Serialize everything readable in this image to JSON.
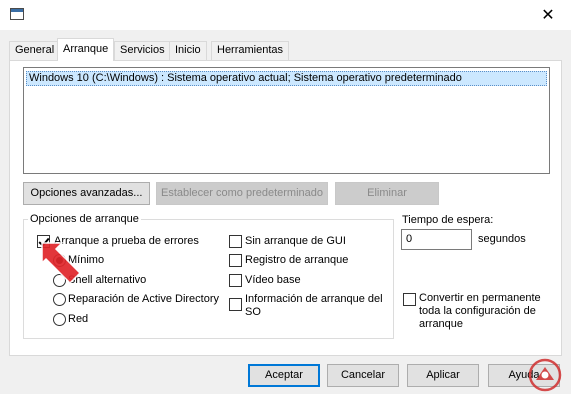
{
  "window": {
    "close_glyph": "✕"
  },
  "tabs": [
    {
      "label": "General"
    },
    {
      "label": "Arranque"
    },
    {
      "label": "Servicios"
    },
    {
      "label": "Inicio"
    },
    {
      "label": "Herramientas"
    }
  ],
  "active_tab": "Arranque",
  "boot_entries": [
    {
      "label": "Windows 10 (C:\\Windows) : Sistema operativo actual; Sistema operativo predeterminado",
      "selected": true
    }
  ],
  "entry_buttons": {
    "advanced": "Opciones avanzadas...",
    "set_default": "Establecer como predeterminado",
    "delete": "Eliminar"
  },
  "boot_options": {
    "legend": "Opciones de arranque",
    "safe_boot": {
      "label": "Arranque a prueba de errores",
      "checked": true
    },
    "safe_modes": [
      {
        "label": "Mínimo",
        "selected": true
      },
      {
        "label": "Shell alternativo",
        "selected": false
      },
      {
        "label": "Reparación de Active Directory",
        "selected": false
      },
      {
        "label": "Red",
        "selected": false
      }
    ],
    "no_gui": {
      "label": "Sin arranque de GUI",
      "checked": false
    },
    "boot_log": {
      "label": "Registro de arranque",
      "checked": false
    },
    "base_video": {
      "label": "Vídeo base",
      "checked": false
    },
    "os_boot_info": {
      "label_line1": "Información de arranque del",
      "label_line2": "SO",
      "checked": false
    }
  },
  "timeout": {
    "label": "Tiempo de espera:",
    "value": "0",
    "unit": "segundos"
  },
  "make_permanent": {
    "label_line1": "Convertir en permanente",
    "label_line2": "toda la configuración de",
    "label_line3": "arranque",
    "checked": false
  },
  "dialog_buttons": {
    "ok": "Aceptar",
    "cancel": "Cancelar",
    "apply": "Aplicar",
    "help": "Ayuda"
  },
  "colors": {
    "selection": "#cce8ff",
    "arrow": "#e0262a",
    "watermark": "#cf2e2e"
  },
  "annotation_icon": "red-pointer-arrow-icon",
  "watermark_icon": "logo-watermark-icon"
}
